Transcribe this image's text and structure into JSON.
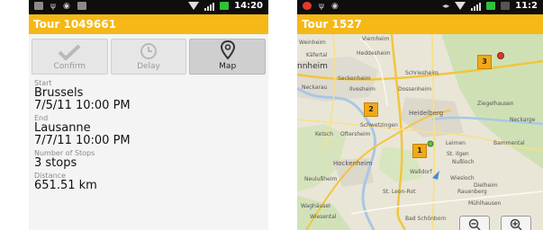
{
  "screen1": {
    "status_time": "14:20",
    "title": "Tour 1049661",
    "actions": [
      {
        "label": "Confirm"
      },
      {
        "label": "Delay"
      },
      {
        "label": "Map"
      }
    ],
    "start": {
      "label": "Start",
      "city": "Brussels",
      "datetime": "7/5/11 10:00 PM"
    },
    "end": {
      "label": "End",
      "city": "Lausanne",
      "datetime": "7/7/11 10:00 PM"
    },
    "stops": {
      "label": "Number of Stops",
      "value": "3 stops"
    },
    "distance": {
      "label": "Distance",
      "value": "651.51 km"
    }
  },
  "screen2": {
    "status_time": "11:2",
    "title": "Tour 1527",
    "places": [
      "Viernheim",
      "Weinheim",
      "Heddesheim",
      "Käfertal",
      "nnheim",
      "Schriesheim",
      "Seckenheim",
      "Neckarau",
      "Ilvesheim",
      "Dossenheim",
      "Ziegelhausen",
      "Heidelberg",
      "Neckarge",
      "Schwetzingen",
      "Ketsch",
      "Oftersheim",
      "Leimen",
      "Bammental",
      "Hockenheim",
      "St. Ilgen",
      "Nußloch",
      "Walldorf",
      "Neulußheim",
      "Wiesloch",
      "Dielheim",
      "St. Leon-Rot",
      "Rauenberg",
      "Mühlhausen",
      "Waghäusel",
      "Wiesental",
      "Bad Schönborn"
    ],
    "stops": [
      "1",
      "2",
      "3"
    ]
  },
  "colors": {
    "accent": "#f5b816",
    "map_bg": "#e9e6d7"
  }
}
